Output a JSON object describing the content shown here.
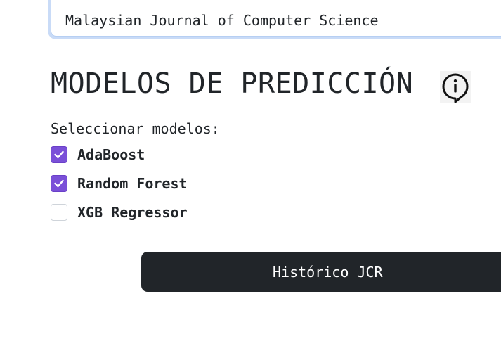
{
  "journal_field": {
    "value": "Malaysian Journal of Computer Science"
  },
  "section": {
    "title": "MODELOS DE PREDICCIÓN",
    "info_icon": "info-icon"
  },
  "models": {
    "label": "Seleccionar modelos:",
    "options": [
      {
        "label": "AdaBoost",
        "checked": true
      },
      {
        "label": "Random Forest",
        "checked": true
      },
      {
        "label": "XGB Regressor",
        "checked": false
      }
    ]
  },
  "actions": {
    "historico_label": "Histórico JCR"
  },
  "colors": {
    "checkbox_checked": "#7a50d8",
    "button_bg": "#212529",
    "input_focus": "#c9dbf7"
  }
}
